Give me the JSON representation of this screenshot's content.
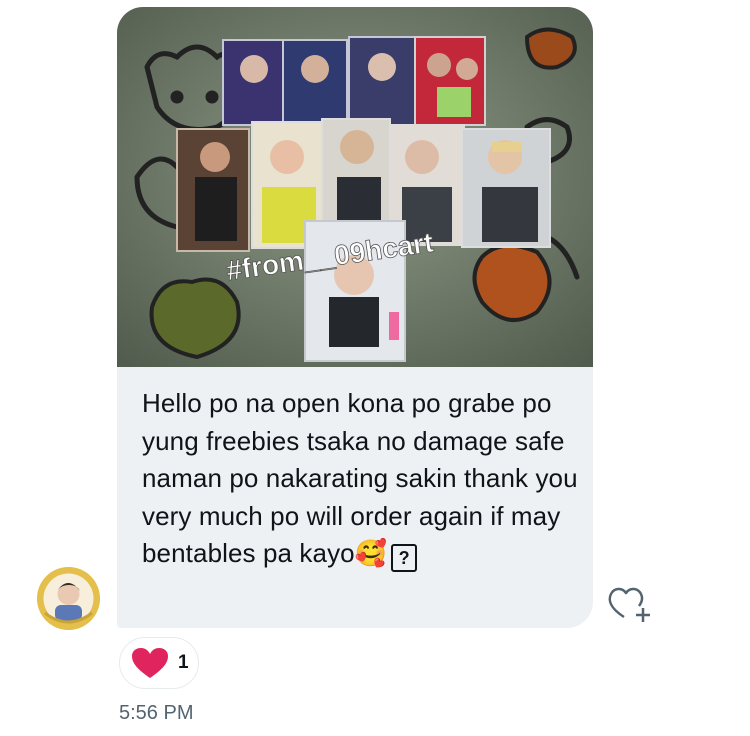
{
  "message": {
    "image_watermark": "#from__09hcart",
    "text": "Hello po na open kona po grabe po yung freebies tsaka no damage safe naman po nakarating sakin thank you very much po will order again if may bentables pa kayo",
    "trailing_emoji": "🥰",
    "unknown_glyph": "?"
  },
  "reaction": {
    "icon": "heart-icon",
    "count": "1",
    "color": "#e0245e"
  },
  "timestamp": "5:56 PM",
  "add_reaction_icon": "heart-plus-icon",
  "colors": {
    "bubble": "#eef1f3",
    "text": "#0f1419",
    "muted": "#536471"
  }
}
